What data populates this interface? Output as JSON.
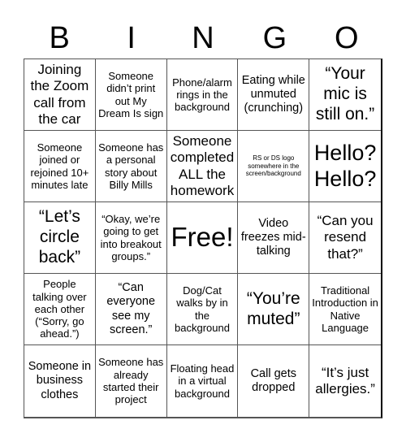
{
  "title_letters": [
    "B",
    "I",
    "N",
    "G",
    "O"
  ],
  "cells": [
    {
      "text": "Joining the Zoom call from the car",
      "size": "s-lg"
    },
    {
      "text": "Someone didn’t print out My Dream Is sign",
      "size": "s-sm"
    },
    {
      "text": "Phone/alarm rings in the background",
      "size": "s-sm"
    },
    {
      "text": "Eating while unmuted (crunching)",
      "size": "s-md"
    },
    {
      "text": "“Your mic is still on.”",
      "size": "s-xl"
    },
    {
      "text": "Someone joined or rejoined 10+ minutes late",
      "size": "s-sm"
    },
    {
      "text": "Someone has a personal story about Billy Mills",
      "size": "s-sm"
    },
    {
      "text": "Someone completed ALL the homework",
      "size": "s-lg"
    },
    {
      "text": "RS or DS logo somewhere in the screen/background",
      "size": "s-xs"
    },
    {
      "text": "Hello? Hello?",
      "size": "s-xxl"
    },
    {
      "text": "“Let’s circle back”",
      "size": "s-xl"
    },
    {
      "text": "“Okay, we’re going to get into breakout groups.”",
      "size": "s-sm"
    },
    {
      "text": "Free!",
      "size": "s-free"
    },
    {
      "text": "Video freezes mid-talking",
      "size": "s-md"
    },
    {
      "text": "“Can you resend that?”",
      "size": "s-lg"
    },
    {
      "text": "People talking over each other (“Sorry, go ahead.”)",
      "size": "s-sm"
    },
    {
      "text": "“Can everyone see my screen.”",
      "size": "s-md"
    },
    {
      "text": "Dog/Cat walks by in the background",
      "size": "s-sm"
    },
    {
      "text": "“You’re muted”",
      "size": "s-xl"
    },
    {
      "text": "Traditional Introduction in Native Language",
      "size": "s-sm"
    },
    {
      "text": "Someone in business clothes",
      "size": "s-md"
    },
    {
      "text": "Someone has already started their project",
      "size": "s-sm"
    },
    {
      "text": "Floating head in a virtual background",
      "size": "s-sm"
    },
    {
      "text": "Call gets dropped",
      "size": "s-md"
    },
    {
      "text": "“It’s just allergies.”",
      "size": "s-lg"
    }
  ]
}
